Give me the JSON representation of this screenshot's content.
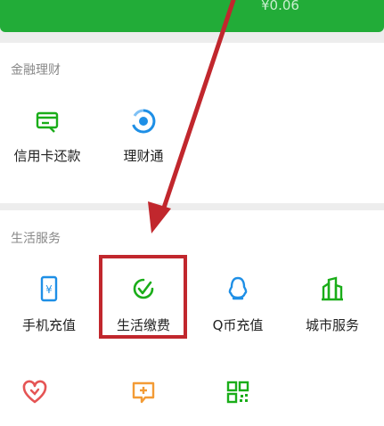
{
  "balance": "¥0.06",
  "finance": {
    "title": "金融理财",
    "items": [
      {
        "label": "信用卡还款",
        "icon": "credit-card-icon"
      },
      {
        "label": "理财通",
        "icon": "wealth-icon"
      }
    ]
  },
  "life": {
    "title": "生活服务",
    "items": [
      {
        "label": "手机充值",
        "icon": "phone-recharge-icon"
      },
      {
        "label": "生活缴费",
        "icon": "utility-payment-icon"
      },
      {
        "label": "Q币充值",
        "icon": "qq-coin-icon"
      },
      {
        "label": "城市服务",
        "icon": "city-service-icon"
      }
    ]
  },
  "colors": {
    "brand_green": "#22ac38",
    "icon_green": "#1aad19",
    "icon_blue": "#1e8fe6",
    "icon_red": "#e55454",
    "icon_orange": "#f39b35",
    "annotation_red": "#c1272d"
  }
}
